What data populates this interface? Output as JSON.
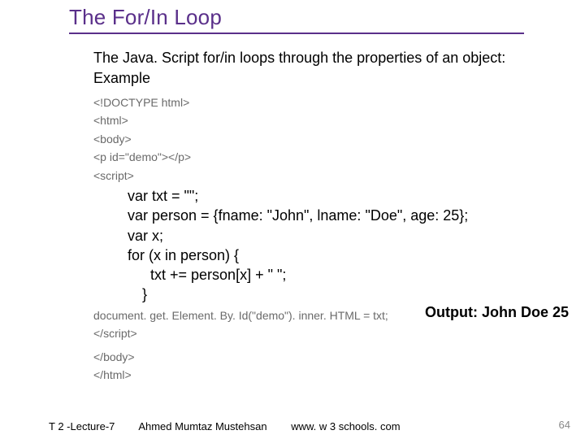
{
  "title": "The For/In Loop",
  "intro": "The Java. Script for/in loops through the properties of an object:",
  "example_label": "Example",
  "code": {
    "l1": "<!DOCTYPE html>",
    "l2": "<html>",
    "l3": "<body>",
    "l4": "<p id=\"demo\"></p>",
    "l5": "<script>",
    "b1": "var txt = \"\";",
    "b2": "var person = {fname: \"John\", lname: \"Doe\", age: 25};",
    "b3": "var x;",
    "b4": "for (x in person) {",
    "b5": "txt += person[x] + \" \";",
    "b6": "}",
    "l6": "document. get. Element. By. Id(\"demo\"). inner. HTML = txt;",
    "l7": "</script>",
    "l8": "</body>",
    "l9": "</html>"
  },
  "output_label": "Output: John Doe 25",
  "footer": {
    "lecture": "T 2 -Lecture-7",
    "author": "Ahmed Mumtaz Mustehsan",
    "site": "www. w 3 schools. com"
  },
  "page_number": "64"
}
